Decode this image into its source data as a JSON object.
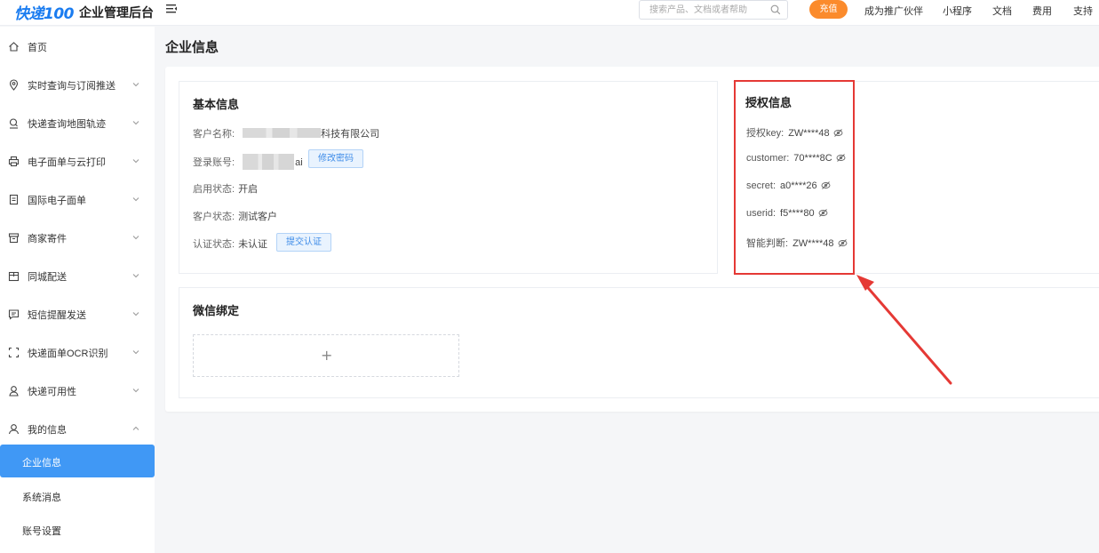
{
  "header": {
    "logo": "快递100",
    "app_title": "企业管理后台",
    "search_placeholder": "搜索产品、文档或者帮助",
    "recharge_label": "充值",
    "nav": [
      "成为推广伙伴",
      "小程序",
      "文档",
      "费用",
      "支持"
    ]
  },
  "sidebar": {
    "items": [
      {
        "label": "首页",
        "icon": "home-icon"
      },
      {
        "label": "实时查询与订阅推送",
        "icon": "location-pin-icon"
      },
      {
        "label": "快递查询地图轨迹",
        "icon": "map-search-icon"
      },
      {
        "label": "电子面单与云打印",
        "icon": "printer-icon"
      },
      {
        "label": "国际电子面单",
        "icon": "document-icon"
      },
      {
        "label": "商家寄件",
        "icon": "box-icon"
      },
      {
        "label": "同城配送",
        "icon": "package-icon"
      },
      {
        "label": "短信提醒发送",
        "icon": "message-icon"
      },
      {
        "label": "快递面单OCR识别",
        "icon": "scan-icon"
      },
      {
        "label": "快递可用性",
        "icon": "user-check-icon"
      },
      {
        "label": "我的信息",
        "icon": "user-icon"
      }
    ],
    "sub_items": [
      {
        "label": "企业信息",
        "active": true
      },
      {
        "label": "系统消息",
        "active": false
      },
      {
        "label": "账号设置",
        "active": false
      }
    ]
  },
  "page": {
    "title": "企业信息",
    "basic_info": {
      "title": "基本信息",
      "customer_name_label": "客户名称:",
      "customer_name_suffix": "科技有限公司",
      "account_label": "登录账号:",
      "account_suffix": "ai",
      "change_password_label": "修改密码",
      "enable_status_label": "启用状态:",
      "enable_status_value": "开启",
      "customer_status_label": "客户状态:",
      "customer_status_value": "测试客户",
      "auth_status_label": "认证状态:",
      "auth_status_value": "未认证",
      "submit_auth_label": "提交认证"
    },
    "auth_info": {
      "title": "授权信息",
      "rows": [
        {
          "label": "授权key:",
          "value": "ZW****48"
        },
        {
          "label": "customer:",
          "value": "70****8C"
        },
        {
          "label": "secret:",
          "value": "a0****26"
        },
        {
          "label": "userid:",
          "value": "f5****80"
        },
        {
          "label": "智能判断:",
          "value": "ZW****48"
        }
      ]
    },
    "wechat": {
      "title": "微信绑定",
      "add_symbol": "+"
    }
  },
  "colors": {
    "accent": "#4098f5",
    "recharge": "#fb8b2c",
    "highlight": "#e53935"
  }
}
